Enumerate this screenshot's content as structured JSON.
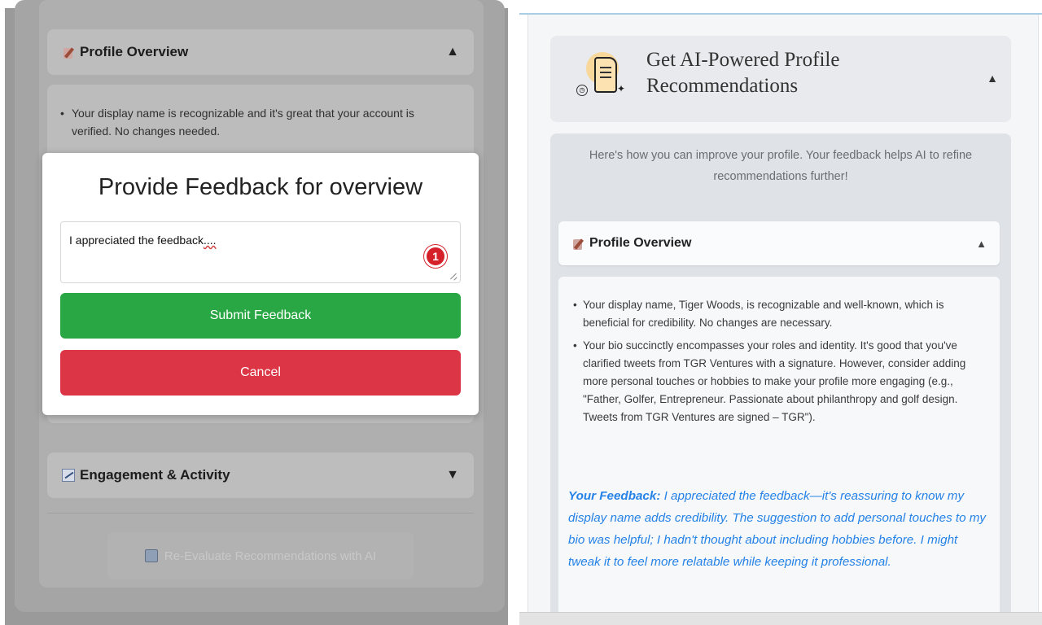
{
  "left": {
    "profile_overview": {
      "title": "Profile Overview",
      "arrow": "▲"
    },
    "overview_bullet": "Your display name is recognizable and it's great that your account is verified. No changes needed.",
    "engagement": {
      "title": "Engagement & Activity",
      "arrow": "▼"
    },
    "reevaluate_label": "Re-Evaluate Recommendations with AI",
    "modal": {
      "title": "Provide Feedback for overview",
      "textarea_value_main": "I appreciated the feedback",
      "textarea_value_squiggle": "....",
      "badge_count": "1",
      "submit_label": "Submit Feedback",
      "cancel_label": "Cancel"
    }
  },
  "right": {
    "header": {
      "title": "Get AI-Powered Profile Recommendations",
      "arrow": "▲"
    },
    "intro": "Here's how you can improve your profile. Your feedback helps AI to refine recommendations further!",
    "profile_overview": {
      "title": "Profile Overview",
      "arrow": "▲"
    },
    "bullets": [
      "Your display name, Tiger Woods, is recognizable and well-known, which is beneficial for credibility. No changes are necessary.",
      "Your bio succinctly encompasses your roles and identity. It's good that you've clarified tweets from TGR Ventures with a signature. However, consider adding more personal touches or hobbies to make your profile more engaging (e.g., \"Father, Golfer, Entrepreneur. Passionate about philanthropy and golf design. Tweets from TGR Ventures are signed – TGR\")."
    ],
    "feedback_label": "Your Feedback:",
    "feedback_text": "I appreciated the feedback—it's reassuring to know my display name adds credibility. The suggestion to add personal touches to my bio was helpful; I hadn't thought about including hobbies before. I might tweak it to feel more relatable while keeping it professional."
  }
}
